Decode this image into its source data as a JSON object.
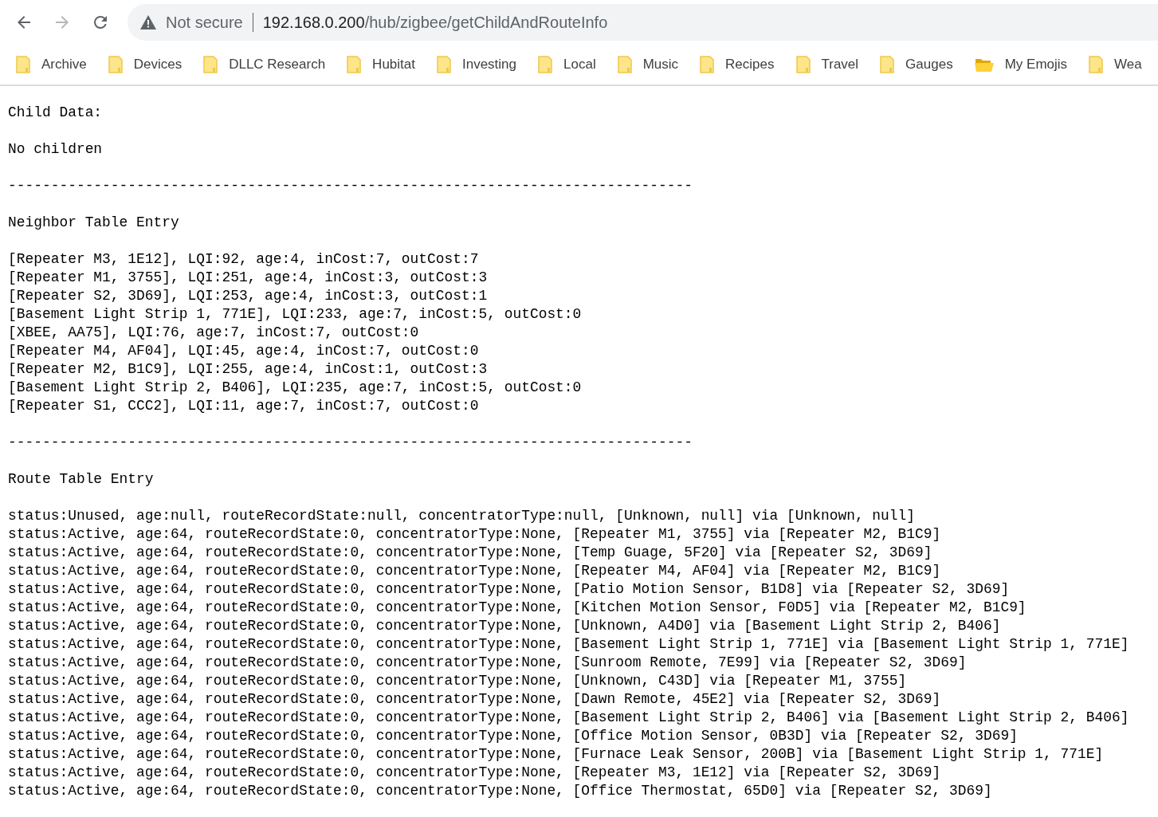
{
  "browser": {
    "security_label": "Not secure",
    "url_host": "192.168.0.200",
    "url_path": "/hub/zigbee/getChildAndRouteInfo"
  },
  "bookmarks": [
    {
      "label": "Archive",
      "kind": "folder"
    },
    {
      "label": "Devices",
      "kind": "folder"
    },
    {
      "label": "DLLC Research",
      "kind": "folder"
    },
    {
      "label": "Hubitat",
      "kind": "folder"
    },
    {
      "label": "Investing",
      "kind": "folder"
    },
    {
      "label": "Local",
      "kind": "folder"
    },
    {
      "label": "Music",
      "kind": "folder"
    },
    {
      "label": "Recipes",
      "kind": "folder"
    },
    {
      "label": "Travel",
      "kind": "folder"
    },
    {
      "label": "Gauges",
      "kind": "folder"
    },
    {
      "label": "My Emojis",
      "kind": "open-folder"
    },
    {
      "label": "Wea",
      "kind": "folder"
    }
  ],
  "blocks": [
    {
      "lines": [
        "Child Data:"
      ]
    },
    {
      "lines": [
        "No children"
      ]
    },
    {
      "lines": [
        "--------------------------------------------------------------------------------"
      ]
    },
    {
      "lines": [
        "Neighbor Table Entry"
      ]
    },
    {
      "lines": [
        "[Repeater M3, 1E12], LQI:92, age:4, inCost:7, outCost:7",
        "[Repeater M1, 3755], LQI:251, age:4, inCost:3, outCost:3",
        "[Repeater S2, 3D69], LQI:253, age:4, inCost:3, outCost:1",
        "[Basement Light Strip 1, 771E], LQI:233, age:7, inCost:5, outCost:0",
        "[XBEE, AA75], LQI:76, age:7, inCost:7, outCost:0",
        "[Repeater M4, AF04], LQI:45, age:4, inCost:7, outCost:0",
        "[Repeater M2, B1C9], LQI:255, age:4, inCost:1, outCost:3",
        "[Basement Light Strip 2, B406], LQI:235, age:7, inCost:5, outCost:0",
        "[Repeater S1, CCC2], LQI:11, age:7, inCost:7, outCost:0"
      ]
    },
    {
      "lines": [
        "--------------------------------------------------------------------------------"
      ]
    },
    {
      "lines": [
        "Route Table Entry"
      ]
    },
    {
      "lines": [
        "status:Unused, age:null, routeRecordState:null, concentratorType:null, [Unknown, null] via [Unknown, null]",
        "status:Active, age:64, routeRecordState:0, concentratorType:None, [Repeater M1, 3755] via [Repeater M2, B1C9]",
        "status:Active, age:64, routeRecordState:0, concentratorType:None, [Temp Guage, 5F20] via [Repeater S2, 3D69]",
        "status:Active, age:64, routeRecordState:0, concentratorType:None, [Repeater M4, AF04] via [Repeater M2, B1C9]",
        "status:Active, age:64, routeRecordState:0, concentratorType:None, [Patio Motion Sensor, B1D8] via [Repeater S2, 3D69]",
        "status:Active, age:64, routeRecordState:0, concentratorType:None, [Kitchen Motion Sensor, F0D5] via [Repeater M2, B1C9]",
        "status:Active, age:64, routeRecordState:0, concentratorType:None, [Unknown, A4D0] via [Basement Light Strip 2, B406]",
        "status:Active, age:64, routeRecordState:0, concentratorType:None, [Basement Light Strip 1, 771E] via [Basement Light Strip 1, 771E]",
        "status:Active, age:64, routeRecordState:0, concentratorType:None, [Sunroom Remote, 7E99] via [Repeater S2, 3D69]",
        "status:Active, age:64, routeRecordState:0, concentratorType:None, [Unknown, C43D] via [Repeater M1, 3755]",
        "status:Active, age:64, routeRecordState:0, concentratorType:None, [Dawn Remote, 45E2] via [Repeater S2, 3D69]",
        "status:Active, age:64, routeRecordState:0, concentratorType:None, [Basement Light Strip 2, B406] via [Basement Light Strip 2, B406]",
        "status:Active, age:64, routeRecordState:0, concentratorType:None, [Office Motion Sensor, 0B3D] via [Repeater S2, 3D69]",
        "status:Active, age:64, routeRecordState:0, concentratorType:None, [Furnace Leak Sensor, 200B] via [Basement Light Strip 1, 771E]",
        "status:Active, age:64, routeRecordState:0, concentratorType:None, [Repeater M3, 1E12] via [Repeater S2, 3D69]",
        "status:Active, age:64, routeRecordState:0, concentratorType:None, [Office Thermostat, 65D0] via [Repeater S2, 3D69]"
      ]
    }
  ]
}
